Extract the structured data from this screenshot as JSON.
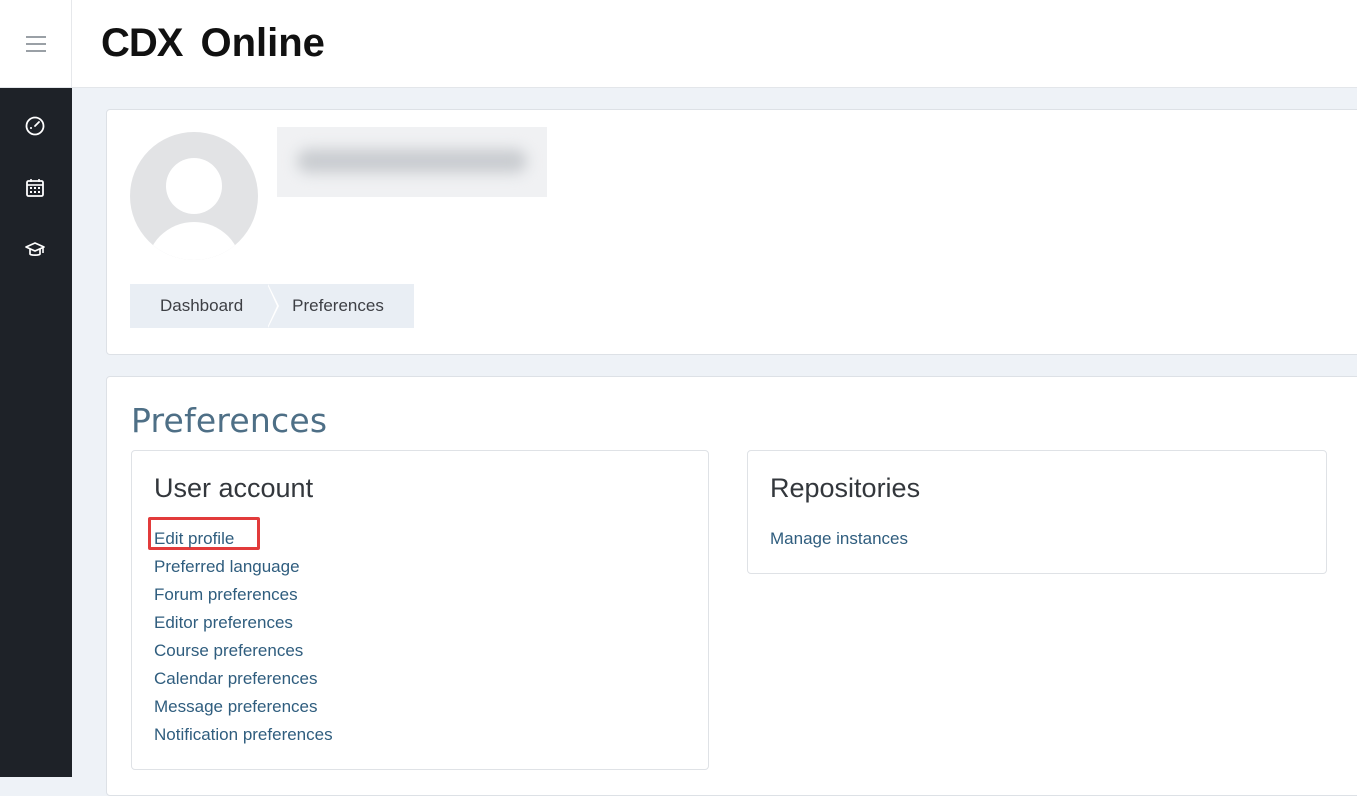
{
  "topbar": {
    "logo_mark": "CDX",
    "logo_text": "Online"
  },
  "sidebar": {
    "icons": [
      "dashboard-gauge-icon",
      "calendar-icon",
      "graduation-cap-icon"
    ]
  },
  "header": {
    "breadcrumb": [
      "Dashboard",
      "Preferences"
    ]
  },
  "page": {
    "title": "Preferences"
  },
  "user_account": {
    "heading": "User account",
    "links": [
      "Edit profile",
      "Preferred language",
      "Forum preferences",
      "Editor preferences",
      "Course preferences",
      "Calendar preferences",
      "Message preferences",
      "Notification preferences"
    ],
    "highlighted_link": "Edit profile"
  },
  "repositories": {
    "heading": "Repositories",
    "links": [
      "Manage instances"
    ]
  },
  "colors": {
    "sidebar_bg": "#1e2228",
    "link": "#2f5d7e",
    "title": "#4e6f86",
    "highlight": "#e23b3b"
  }
}
